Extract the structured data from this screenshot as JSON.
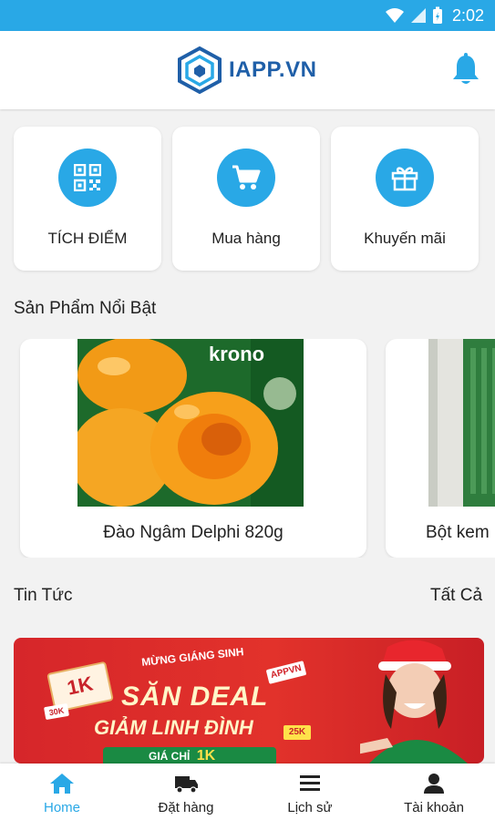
{
  "status_bar": {
    "time": "2:02",
    "icons": [
      "wifi-icon",
      "cell-signal-icon",
      "battery-icon"
    ]
  },
  "header": {
    "logo_text": "IAPP.VN",
    "logo_icon": "cube-logo-icon",
    "bell_icon": "bell-icon"
  },
  "quick_actions": [
    {
      "label": "TÍCH ĐIỂM",
      "icon": "qr-code-icon"
    },
    {
      "label": "Mua hàng",
      "icon": "shopping-cart-icon"
    },
    {
      "label": "Khuyến mãi",
      "icon": "gift-icon"
    }
  ],
  "featured": {
    "title": "Sản Phẩm Nổi Bật",
    "products": [
      {
        "name": "Đào Ngâm Delphi 820g",
        "image_text": "krono"
      },
      {
        "name": "Bột kem"
      }
    ]
  },
  "news": {
    "title": "Tin Tức",
    "see_all": "Tất Cả",
    "banner": {
      "ribbon": "MỪNG GIÁNG SINH",
      "line1": "SĂN DEAL",
      "line2": "GIẢM LINH ĐÌNH",
      "price_prefix": "GIÁ CHỈ",
      "price_value": "1K",
      "ticket": "1K",
      "tag": "APPVN",
      "tag2": "25K",
      "tag3": "30K"
    }
  },
  "bottom_nav": [
    {
      "label": "Home",
      "icon": "home-icon",
      "active": true
    },
    {
      "label": "Đặt hàng",
      "icon": "delivery-truck-icon",
      "active": false
    },
    {
      "label": "Lịch sử",
      "icon": "list-icon",
      "active": false
    },
    {
      "label": "Tài khoản",
      "icon": "person-icon",
      "active": false
    }
  ],
  "colors": {
    "accent": "#29a8e6",
    "brand": "#1f5fa8",
    "background": "#f2f2f2"
  }
}
